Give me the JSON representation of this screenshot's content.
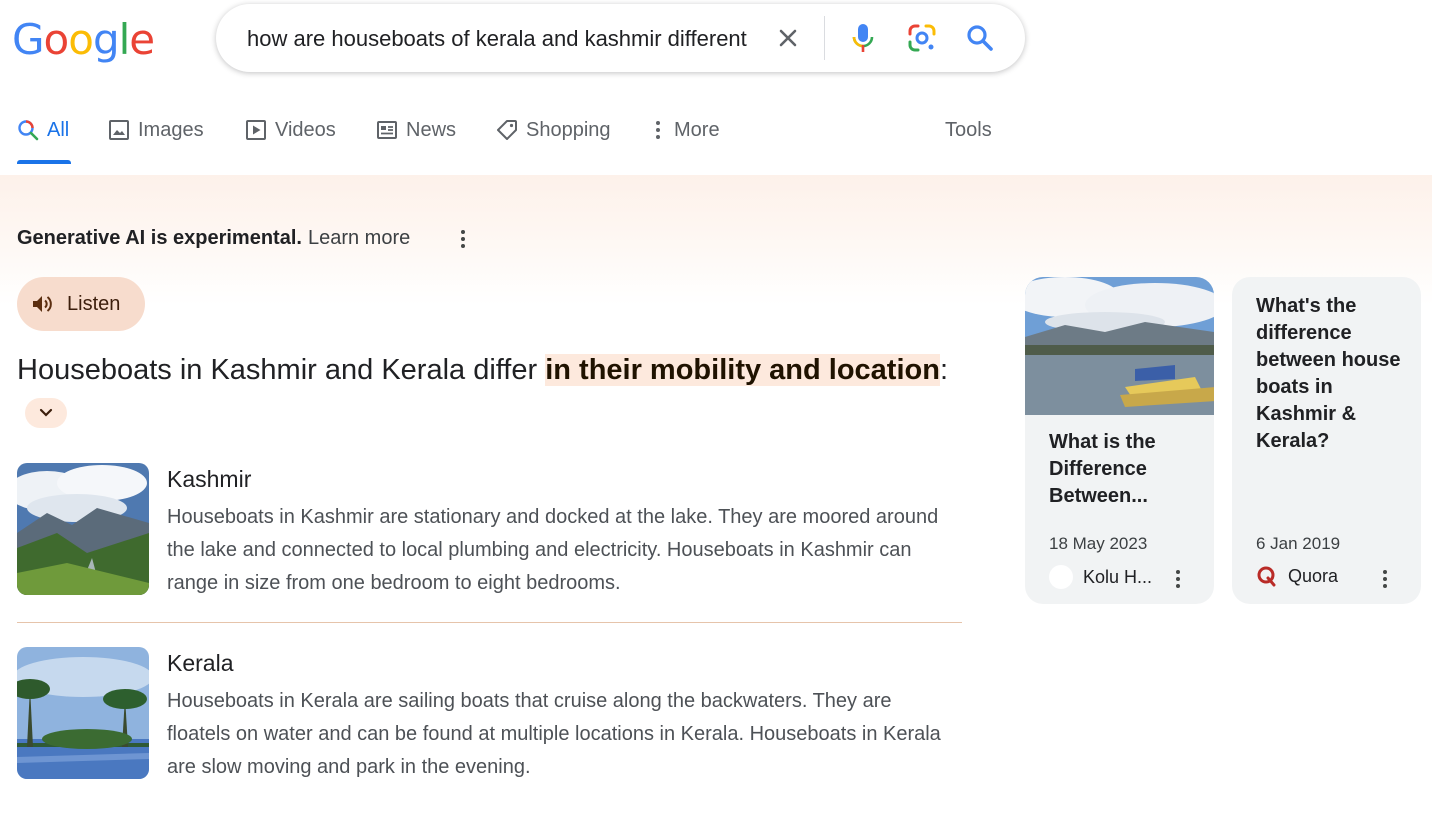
{
  "header": {
    "logo_letters": [
      "G",
      "o",
      "o",
      "g",
      "l",
      "e"
    ],
    "search": {
      "value": "how are houseboats of kerala and kashmir different",
      "icons": [
        "close-icon",
        "mic-icon",
        "lens-icon",
        "search-icon"
      ]
    }
  },
  "tabs": [
    {
      "label": "All",
      "icon": "search-icon",
      "active": true
    },
    {
      "label": "Images",
      "icon": "image-icon"
    },
    {
      "label": "Videos",
      "icon": "play-icon"
    },
    {
      "label": "News",
      "icon": "newspaper-icon"
    },
    {
      "label": "Shopping",
      "icon": "tag-icon"
    },
    {
      "label": "More",
      "icon": "kebab-icon"
    },
    {
      "label": "Tools"
    }
  ],
  "ai_overview": {
    "note_bold": "Generative AI is experimental.",
    "note_link": "Learn more",
    "listen_label": "Listen",
    "headline_plain": "Houseboats in Kashmir and Kerala differ ",
    "headline_highlight": "in their mobility and location",
    "headline_colon": ":",
    "items": [
      {
        "title": "Kashmir",
        "description": "Houseboats in Kashmir are stationary and docked at the lake. They are moored around the lake and connected to local plumbing and electricity. Houseboats in Kashmir can range in size from one bedroom to eight bedrooms.",
        "image": "mountain-valley-image"
      },
      {
        "title": "Kerala",
        "description": "Houseboats in Kerala are sailing boats that cruise along the backwaters. They are floatels on water and can be found at multiple locations in Kerala. Houseboats in Kerala are slow moving and park in the evening.",
        "image": "palm-backwaters-image"
      }
    ],
    "sources": [
      {
        "title": "What is the Difference Between...",
        "date": "18 May 2023",
        "source": "Kolu H...",
        "image": "lake-houseboats-image"
      },
      {
        "title": "What's the difference between house boats in Kashmir & Kerala?",
        "date": "6 Jan 2019",
        "source": "Quora",
        "source_icon": "quora-icon"
      }
    ]
  },
  "colors": {
    "accent": "#1a73e8",
    "listen_bg": "#f7dccd",
    "highlight_bg": "#fde9dd",
    "card_bg": "#f1f3f4"
  }
}
